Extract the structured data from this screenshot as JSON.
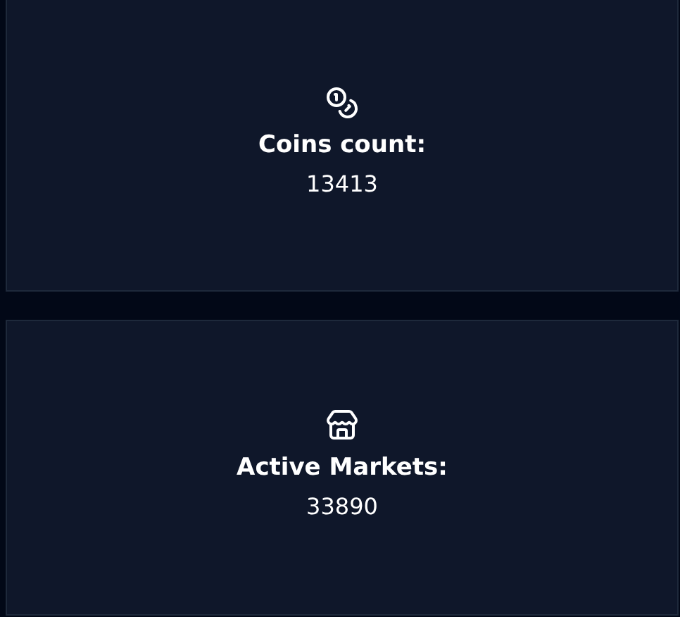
{
  "cards": [
    {
      "kind": "coins",
      "label": "Coins count:",
      "value": "13413"
    },
    {
      "kind": "store",
      "label": "Active Markets:",
      "value": "33890"
    }
  ]
}
